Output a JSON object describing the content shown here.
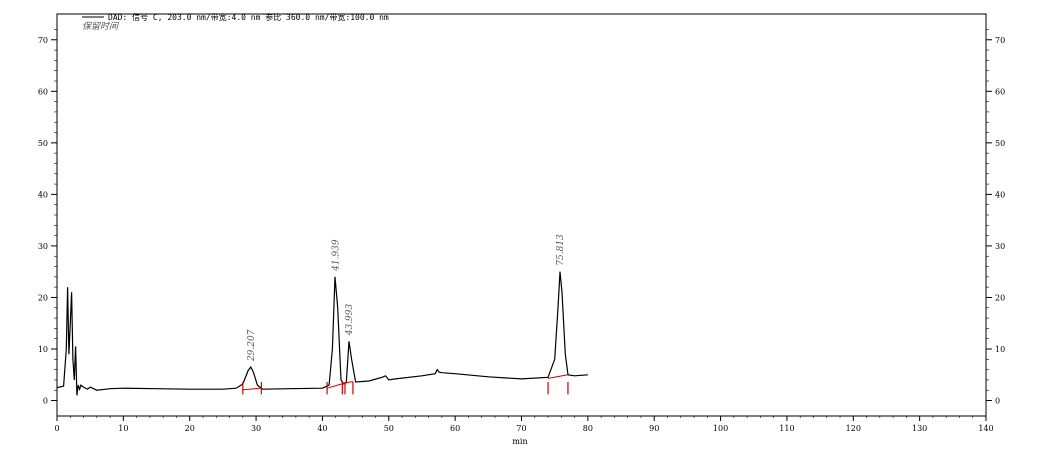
{
  "chart_data": {
    "type": "line",
    "legend": {
      "signal": "DAD: 信号 C, 203.0 nm/带宽:4.0 nm 参比 360.0 nm/带宽:100.0 nm",
      "subtitle": "保留时间"
    },
    "xlabel": "min",
    "xlim": [
      0,
      140
    ],
    "ylim": [
      -3,
      75
    ],
    "x_ticks": [
      0,
      10,
      20,
      30,
      40,
      50,
      60,
      70,
      80,
      90,
      100,
      110,
      120,
      130,
      140
    ],
    "y_ticks": [
      0,
      10,
      20,
      30,
      40,
      50,
      60,
      70
    ],
    "series": [
      {
        "x": [
          0,
          1.0,
          1.4,
          1.6,
          1.8,
          2.0,
          2.2,
          2.4,
          2.6,
          2.8,
          3.0,
          3.2,
          3.4,
          3.6,
          4.0,
          4.6,
          5.0,
          6.0,
          8.0,
          10.0,
          15.0,
          20.0,
          25.0,
          27.0,
          28.0,
          28.8,
          29.2,
          29.6,
          30.2,
          31.0,
          35.0,
          40.0,
          41.0,
          41.5,
          41.9,
          42.3,
          42.8,
          43.2,
          43.6,
          44.0,
          44.4,
          45.0,
          47.0,
          49.0,
          49.5,
          50.0,
          51.0,
          55.0,
          57.0,
          57.3,
          57.6,
          58.0,
          60.0,
          65.0,
          70.0,
          74.0,
          75.0,
          75.5,
          75.8,
          76.1,
          76.6,
          77.0,
          78.0,
          80.0
        ],
        "y": [
          2.5,
          2.8,
          10.0,
          22.0,
          9.0,
          15.0,
          21.0,
          8.0,
          4.0,
          10.5,
          1.0,
          3.0,
          2.2,
          3.0,
          2.6,
          2.2,
          2.6,
          2.0,
          2.3,
          2.4,
          2.3,
          2.2,
          2.2,
          2.4,
          3.2,
          5.8,
          6.5,
          5.5,
          3.0,
          2.2,
          2.3,
          2.4,
          3.0,
          10.0,
          24.0,
          18.0,
          4.0,
          3.2,
          3.5,
          11.5,
          8.0,
          3.6,
          3.8,
          4.5,
          4.8,
          4.0,
          4.2,
          4.8,
          5.2,
          6.0,
          5.5,
          5.4,
          5.2,
          4.6,
          4.2,
          4.5,
          8.0,
          18.0,
          25.0,
          21.0,
          9.0,
          5.0,
          4.8,
          5.0
        ]
      }
    ],
    "annotations": [
      {
        "text": "29.207",
        "x": 29.207,
        "y": 6.5
      },
      {
        "text": "41.939",
        "x": 41.939,
        "y": 24.0
      },
      {
        "text": "43.993",
        "x": 43.993,
        "y": 11.5
      },
      {
        "text": "75.813",
        "x": 75.813,
        "y": 25.0
      }
    ],
    "integration_marks": [
      28.0,
      30.8,
      40.7,
      43.0,
      43.4,
      44.6,
      74.0,
      77.0
    ]
  }
}
